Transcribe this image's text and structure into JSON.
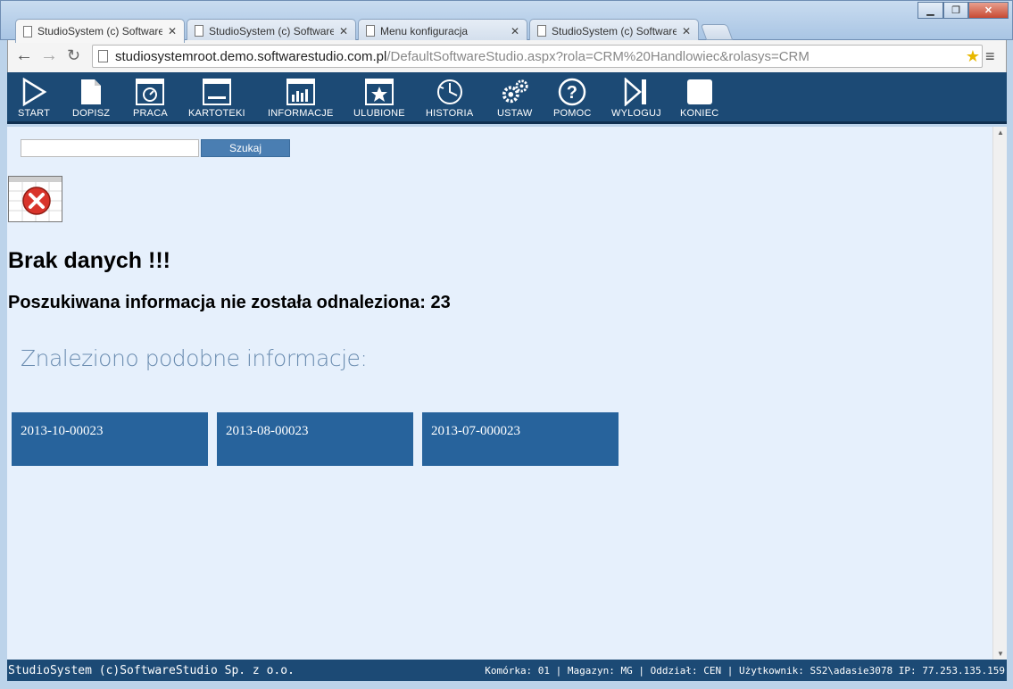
{
  "browser": {
    "tabs": [
      {
        "title": "StudioSystem (c) Software",
        "close": "✕"
      },
      {
        "title": "StudioSystem (c) Software",
        "close": "✕"
      },
      {
        "title": "Menu konfiguracja",
        "close": "✕"
      },
      {
        "title": "StudioSystem (c) Software",
        "close": "✕"
      }
    ],
    "url_host": "studiosystemroot.demo.softwarestudio.com.pl",
    "url_path": "/DefaultSoftwareStudio.aspx?rola=CRM%20Handlowiec&rolasys=CRM"
  },
  "nav": {
    "items": [
      {
        "label": "START",
        "icon": "play-icon"
      },
      {
        "label": "DOPISZ",
        "icon": "document-icon"
      },
      {
        "label": "PRACA",
        "icon": "window-clock-icon"
      },
      {
        "label": "KARTOTEKI",
        "icon": "window-icon"
      },
      {
        "label": "INFORMACJE",
        "icon": "bar-chart-icon"
      },
      {
        "label": "ULUBIONE",
        "icon": "star-window-icon"
      },
      {
        "label": "HISTORIA",
        "icon": "history-icon"
      },
      {
        "label": "USTAW",
        "icon": "gears-icon"
      },
      {
        "label": "POMOC",
        "icon": "help-icon"
      },
      {
        "label": "WYLOGUJ",
        "icon": "logout-icon"
      },
      {
        "label": "KONIEC",
        "icon": "square-icon"
      }
    ]
  },
  "search": {
    "value": "",
    "button_label": "Szukaj"
  },
  "content": {
    "title": "Brak danych !!!",
    "subtitle": "Poszukiwana informacja nie została odnaleziona: 23",
    "similar_title": "Znaleziono podobne informacje:",
    "results": [
      "2013-10-00023",
      "2013-08-00023",
      "2013-07-000023"
    ]
  },
  "status": {
    "left": "StudioSystem (c)SoftwareStudio Sp. z o.o.",
    "right": "Komórka: 01 | Magazyn: MG | Oddział: CEN | Użytkownik: SS2\\adasie3078 IP: 77.253.135.159"
  },
  "colors": {
    "nav_bg": "#1c4a75",
    "page_bg": "#e6f0fc",
    "tile_bg": "#27639c",
    "similar_title": "#6a8cb0"
  }
}
